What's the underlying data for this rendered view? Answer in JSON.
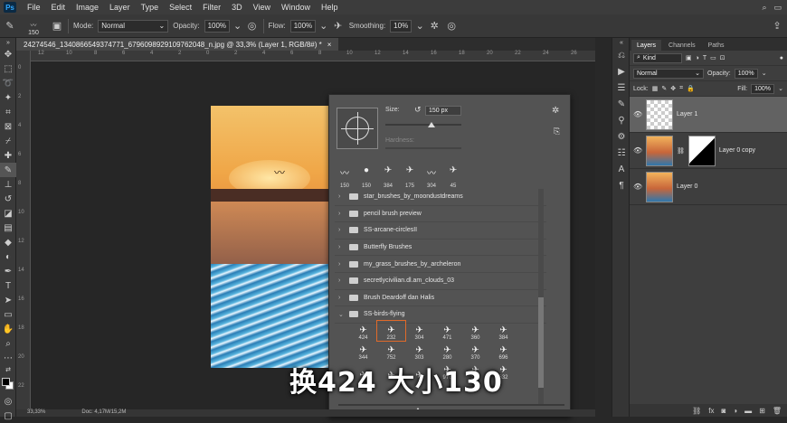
{
  "menu": {
    "logo": "Ps",
    "items": [
      "File",
      "Edit",
      "Image",
      "Layer",
      "Type",
      "Select",
      "Filter",
      "3D",
      "View",
      "Window",
      "Help"
    ]
  },
  "options": {
    "brush_size": "150",
    "mode_label": "Mode:",
    "mode_value": "Normal",
    "opacity_label": "Opacity:",
    "opacity_value": "100%",
    "flow_label": "Flow:",
    "flow_value": "100%",
    "smoothing_label": "Smoothing:",
    "smoothing_value": "10%"
  },
  "document": {
    "tab_title": "24274546_1340866549374771_6796098929109762048_n.jpg @ 33,3% (Layer 1, RGB/8#) *",
    "close": "×"
  },
  "rulers": {
    "top": [
      "12",
      "10",
      "8",
      "6",
      "4",
      "2",
      "0",
      "2",
      "4",
      "6",
      "8",
      "10",
      "12",
      "14",
      "16",
      "18",
      "20",
      "22",
      "24",
      "26"
    ],
    "left": [
      "0",
      "2",
      "4",
      "6",
      "8",
      "10",
      "12",
      "14",
      "16",
      "18",
      "20",
      "22"
    ]
  },
  "brush_panel": {
    "size_label": "Size:",
    "size_value": "150 px",
    "hardness_label": "Hardness:",
    "presets": [
      {
        "size": "150",
        "mark": "〰"
      },
      {
        "size": "150",
        "mark": "●"
      },
      {
        "size": "384",
        "mark": "✈"
      },
      {
        "size": "175",
        "mark": "✈"
      },
      {
        "size": "304",
        "mark": "〰"
      },
      {
        "size": "45",
        "mark": "✈"
      }
    ],
    "folders": [
      {
        "name": "star_brushes_by_moondustdreams",
        "open": false
      },
      {
        "name": "pencil brush preview",
        "open": false
      },
      {
        "name": "SS-arcane-circlesII",
        "open": false
      },
      {
        "name": "Butterfly Brushes",
        "open": false
      },
      {
        "name": "my_grass_brushes_by_archeleron",
        "open": false
      },
      {
        "name": "secretlycivilian.dl.am_clouds_03",
        "open": false
      },
      {
        "name": "Brush Deardoff dan Halis",
        "open": false
      },
      {
        "name": "SS-birds-flying",
        "open": true
      }
    ],
    "birds": [
      {
        "size": "424",
        "sel": false
      },
      {
        "size": "232",
        "sel": true
      },
      {
        "size": "304",
        "sel": false
      },
      {
        "size": "471",
        "sel": false
      },
      {
        "size": "360",
        "sel": false
      },
      {
        "size": "384",
        "sel": false
      },
      {
        "size": "344",
        "sel": false
      },
      {
        "size": "752",
        "sel": false
      },
      {
        "size": "303",
        "sel": false
      },
      {
        "size": "280",
        "sel": false
      },
      {
        "size": "370",
        "sel": false
      },
      {
        "size": "696",
        "sel": false
      },
      {
        "size": "",
        "sel": false
      },
      {
        "size": "",
        "sel": false
      },
      {
        "size": "",
        "sel": false
      },
      {
        "size": "976",
        "sel": false
      },
      {
        "size": "300",
        "sel": false
      },
      {
        "size": "632",
        "sel": false
      }
    ]
  },
  "subtitle": "换424 大小130",
  "status": {
    "zoom": "33,33%",
    "doc": "Doc: 4,17M/15,2M"
  },
  "layers": {
    "tabs": [
      "Layers",
      "Channels",
      "Paths"
    ],
    "kind_value": "Kind",
    "blend_value": "Normal",
    "opacity_label": "Opacity:",
    "opacity_value": "100%",
    "lock_label": "Lock:",
    "fill_label": "Fill:",
    "fill_value": "100%",
    "items": [
      {
        "name": "Layer 1",
        "selected": true,
        "thumb": "trans",
        "mask": false
      },
      {
        "name": "Layer 0 copy",
        "selected": false,
        "thumb": "photo",
        "mask": true
      },
      {
        "name": "Layer 0",
        "selected": false,
        "thumb": "photo",
        "mask": false
      }
    ],
    "footer_icons": [
      "link-icon",
      "fx-icon",
      "mask-icon",
      "adjust-icon",
      "folder-icon",
      "new-layer-icon",
      "trash-icon"
    ]
  }
}
